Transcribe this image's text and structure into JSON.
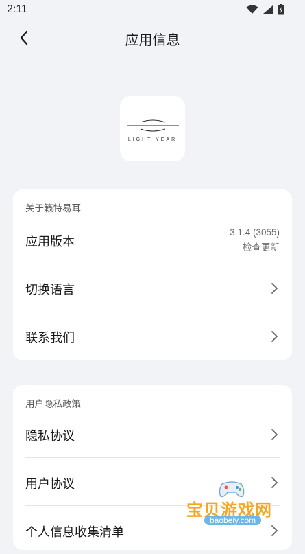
{
  "status_bar": {
    "time": "2:11",
    "icons": [
      "wifi-icon",
      "signal-icon",
      "battery-icon"
    ]
  },
  "header": {
    "title": "应用信息",
    "back_icon": "chevron-left-icon"
  },
  "logo": {
    "text": "LIGHT YEAR"
  },
  "about_section": {
    "title": "关于籁特易耳",
    "version": {
      "label": "应用版本",
      "value": "3.1.4 (3055)",
      "action": "检查更新"
    },
    "items": [
      {
        "label": "切换语言"
      },
      {
        "label": "联系我们"
      }
    ]
  },
  "privacy_section": {
    "title": "用户隐私政策",
    "items": [
      {
        "label": "隐私协议"
      },
      {
        "label": "用户协议"
      },
      {
        "label": "个人信息收集清单"
      }
    ]
  },
  "watermark": {
    "title": "宝贝游戏网",
    "url": "baobeiy.com"
  },
  "colors": {
    "background": "#f2f3f7",
    "card": "#ffffff",
    "text": "#1a1a1a",
    "secondary_text": "#6b6b6b"
  }
}
